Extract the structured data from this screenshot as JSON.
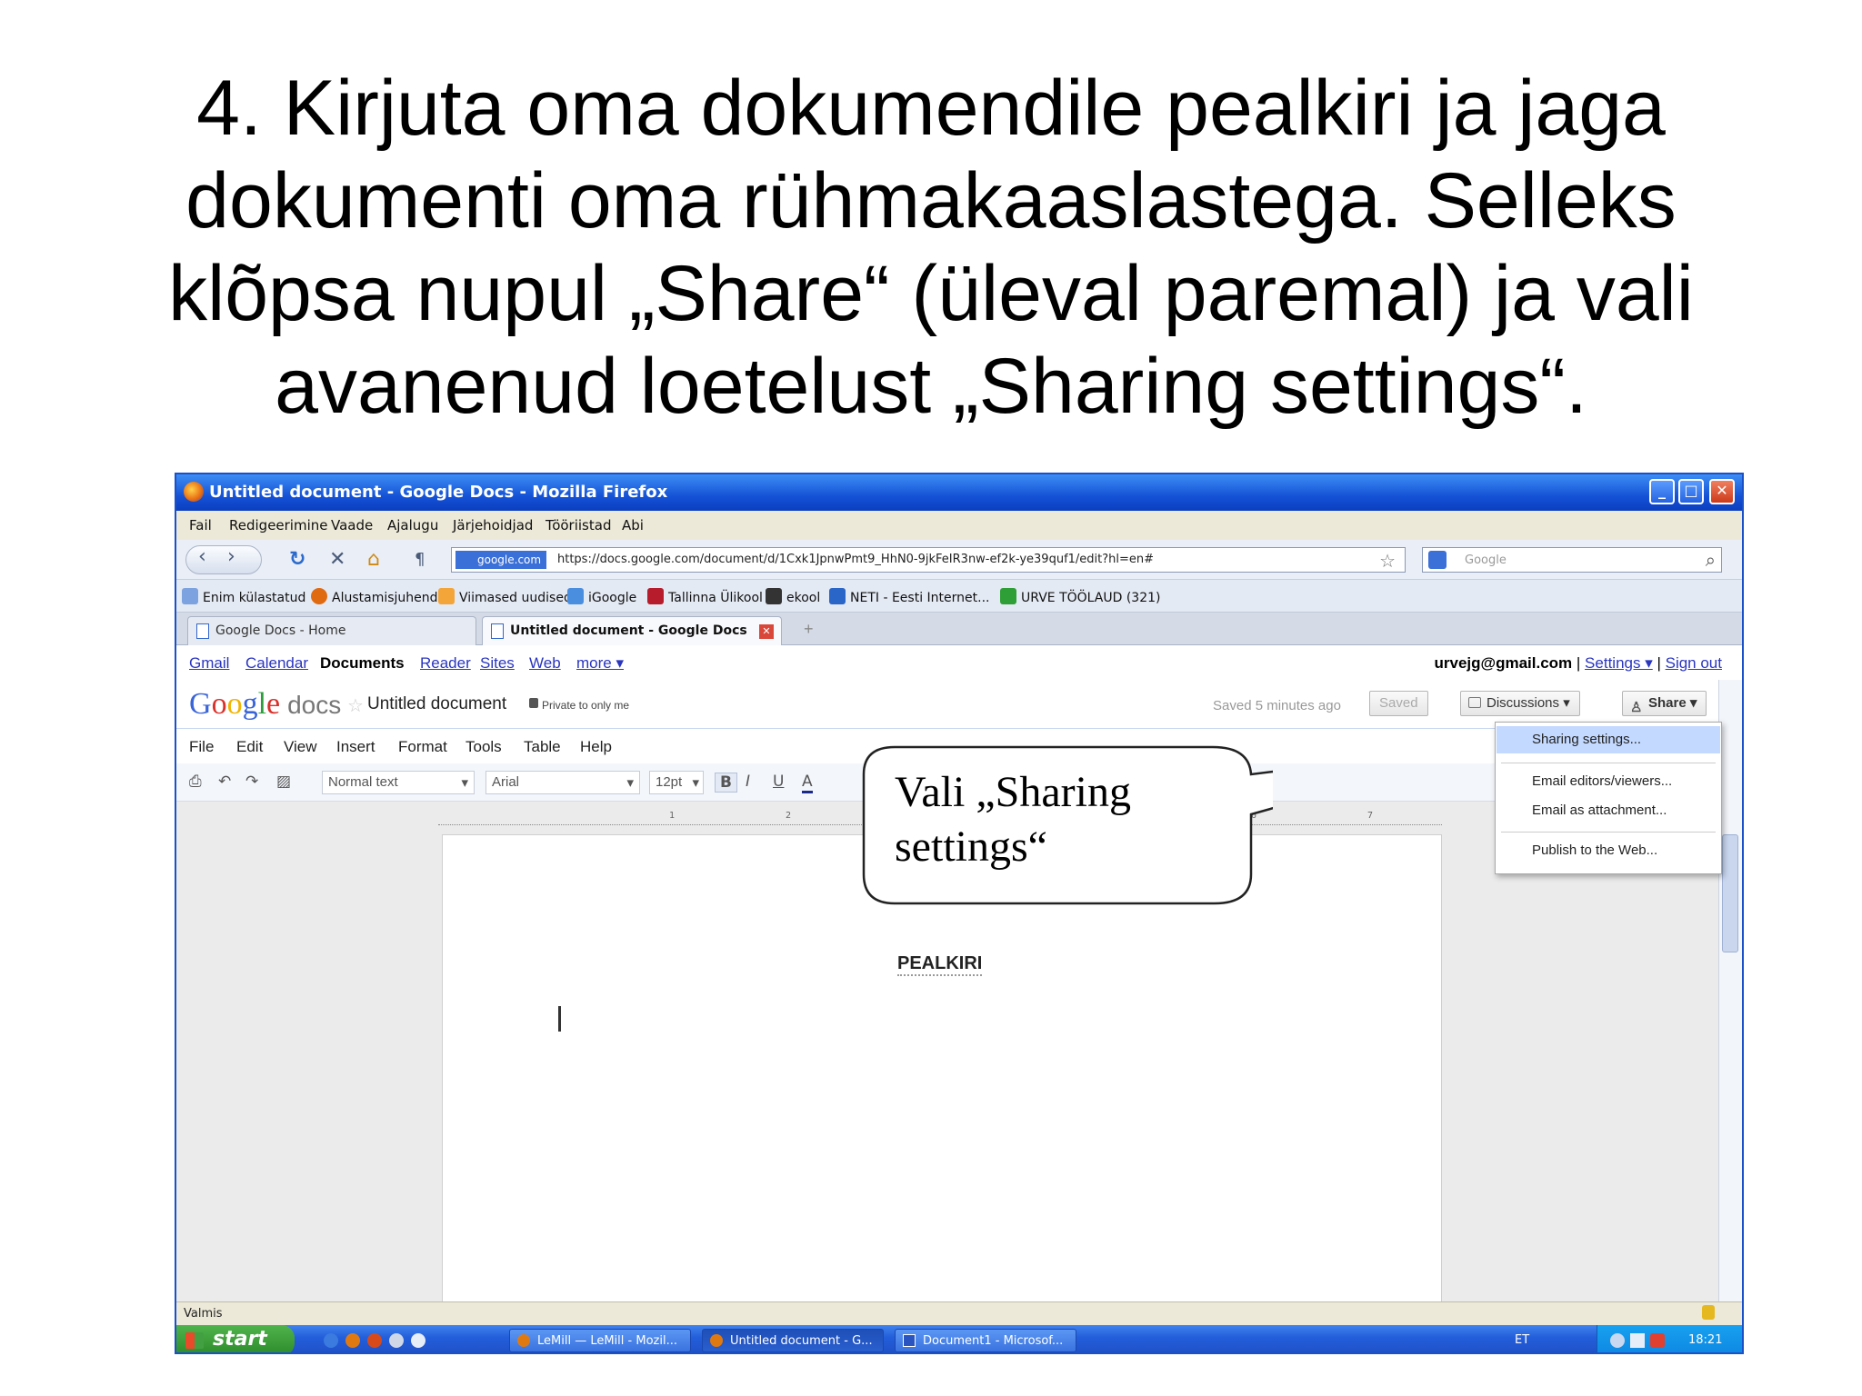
{
  "slide": {
    "title_lines": [
      "4. Kirjuta oma dokumendile pealkiri ja jaga",
      "dokumenti oma rühmakaaslastega. Selleks",
      "klõpsa nupul „Share“ (üleval paremal) ja vali",
      "avanenud loetelust „Sharing settings“."
    ]
  },
  "window": {
    "title": "Untitled document - Google Docs - Mozilla Firefox",
    "menu": [
      "Fail",
      "Redigeerimine",
      "Vaade",
      "Ajalugu",
      "Järjehoidjad",
      "Tööriistad",
      "Abi"
    ]
  },
  "navbar": {
    "site": "google.com",
    "url": "https://docs.google.com/document/d/1Cxk1JpnwPmt9_HhN0-9jkFeIR3nw-ef2k-ye39quf1/edit?hl=en#",
    "search_placeholder": "Google"
  },
  "bookmarks": [
    "Enim külastatud",
    "Alustamisjuhend",
    "Viimased uudised",
    "iGoogle",
    "Tallinna Ülikool",
    "ekool",
    "NETI - Eesti Internet...",
    "URVE TÖÖLAUD (321)"
  ],
  "tabs": [
    {
      "label": "Google Docs - Home",
      "active": false
    },
    {
      "label": "Untitled document - Google Docs",
      "active": true
    }
  ],
  "gbar": {
    "links": [
      "Gmail",
      "Calendar",
      "Documents",
      "Reader",
      "Sites",
      "Web",
      "more ▾"
    ],
    "current": "Documents",
    "email": "urvejg@gmail.com",
    "settings": "Settings ▾",
    "signout": "Sign out"
  },
  "docheader": {
    "logo_google": [
      "G",
      "o",
      "o",
      "g",
      "l",
      "e"
    ],
    "logo_docs": "docs",
    "doc_name": "Untitled document",
    "private": "Private to only me",
    "saved_text": "Saved 5 minutes ago",
    "saved_btn": "Saved",
    "discussions_btn": "Discussions",
    "share_btn": "Share"
  },
  "docmenu": [
    "File",
    "Edit",
    "View",
    "Insert",
    "Format",
    "Tools",
    "Table",
    "Help"
  ],
  "toolbar": {
    "style": "Normal text",
    "font": "Arial",
    "size": "12pt"
  },
  "document": {
    "heading": "PEALKIRI"
  },
  "share_menu": {
    "items": [
      "Sharing settings...",
      "Email editors/viewers...",
      "Email as attachment...",
      "Publish to the Web..."
    ],
    "highlighted": "Sharing settings..."
  },
  "callout": {
    "lines": [
      "Vali „Sharing",
      "settings“"
    ]
  },
  "statusbar": {
    "text": "Valmis"
  },
  "taskbar": {
    "start": "start",
    "tasks": [
      {
        "label": "LeMill — LeMill - Mozil...",
        "active": false
      },
      {
        "label": "Untitled document - G...",
        "active": true
      },
      {
        "label": "Document1 - Microsof...",
        "active": false
      }
    ],
    "lang": "ET",
    "clock": "18:21"
  },
  "colors": {
    "xp_blue": "#1552d6",
    "link": "#2a35c0",
    "menu_highlight": "#c3d9ff",
    "start_green": "#2c8a2a"
  }
}
